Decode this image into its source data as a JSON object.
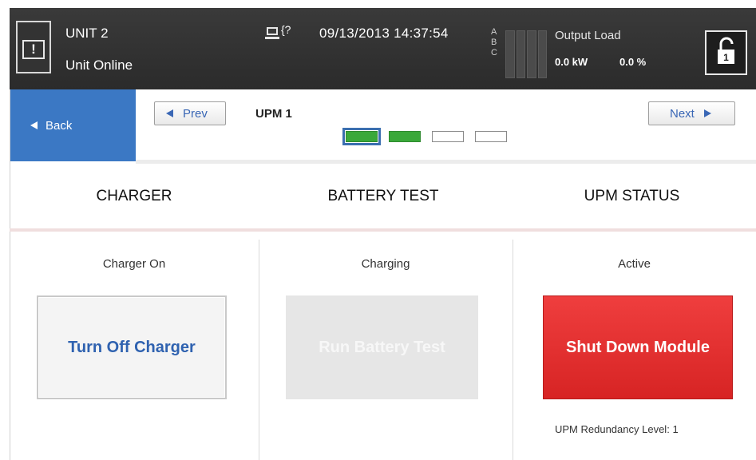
{
  "header": {
    "unit_name": "UNIT 2",
    "unit_status": "Unit Online",
    "network_icon": "network-help-icon",
    "network_glyph": "{?",
    "datetime": "09/13/2013  14:37:54",
    "phases": [
      "A",
      "B",
      "C"
    ],
    "output_title": "Output Load",
    "output_kw": "0.0 kW",
    "output_pct": "0.0 %",
    "alarm_symbol": "!",
    "lock_icon": "unlock-icon"
  },
  "nav": {
    "back_label": "Back",
    "prev_label": "Prev",
    "next_label": "Next",
    "current_page": "UPM 1",
    "pages": [
      {
        "state": "on",
        "current": true
      },
      {
        "state": "on",
        "current": false
      },
      {
        "state": "off",
        "current": false
      },
      {
        "state": "off",
        "current": false
      }
    ]
  },
  "sections": {
    "charger": {
      "heading": "CHARGER",
      "status": "Charger On",
      "button": "Turn Off Charger"
    },
    "battery": {
      "heading": "BATTERY TEST",
      "status": "Charging",
      "button": "Run Battery Test"
    },
    "upm": {
      "heading": "UPM STATUS",
      "status": "Active",
      "button": "Shut Down Module",
      "redundancy_label": "UPM Redundancy Level:",
      "redundancy_value": "1"
    }
  },
  "colors": {
    "accent_blue": "#3b78c4",
    "active_green": "#3aa83a",
    "danger_red": "#e03030",
    "topbar": "#2f2f2f"
  }
}
